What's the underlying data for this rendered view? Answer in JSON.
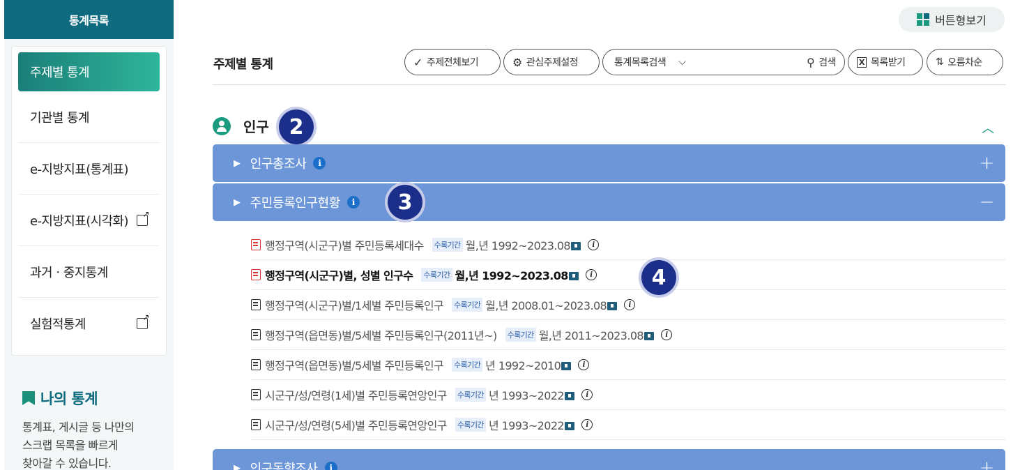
{
  "sidebar": {
    "header": "통계목록",
    "items": [
      {
        "label": "주제별 통계"
      },
      {
        "label": "기관별 통계"
      },
      {
        "label": "e-지방지표(통계표)"
      },
      {
        "label": "e-지방지표(시각화)"
      },
      {
        "label": "과거ㆍ중지통계"
      },
      {
        "label": "실험적통계"
      }
    ],
    "my_stats": {
      "title": "나의 통계",
      "desc_line1": "통계표, 게시글 등 나만의",
      "desc_line2": "스크랩 목록을 빠르게",
      "desc_line3": "찾아갈 수 있습니다."
    }
  },
  "top": {
    "view_button": "버튼형보기"
  },
  "page_title": "주제별 통계",
  "toolbar": {
    "all_topics": "주제전체보기",
    "interest": "관심주제설정",
    "search_select": "통계목록검색",
    "search_button": "검색",
    "download_list": "목록받기",
    "sort": "오름차순"
  },
  "section": {
    "title": "인구"
  },
  "badges": {
    "b2": "2",
    "b3": "3",
    "b4": "4"
  },
  "bands": [
    {
      "label": "인구총조사",
      "toggle": "+"
    },
    {
      "label": "주민등록인구현황",
      "toggle": "−"
    },
    {
      "label": "인구동향조사",
      "toggle": "+"
    }
  ],
  "rows": [
    {
      "name": "행정구역(시군구)별 주민등록세대수",
      "tag": "수록기간",
      "period": "월,년 1992~2023.08"
    },
    {
      "name": "행정구역(시군구)별, 성별 인구수",
      "tag": "수록기간",
      "period": "월,년 1992~2023.08"
    },
    {
      "name": "행정구역(시군구)별/1세별 주민등록인구",
      "tag": "수록기간",
      "period": "월,년 2008.01~2023.08"
    },
    {
      "name": "행정구역(읍면동)별/5세별 주민등록인구(2011년~)",
      "tag": "수록기간",
      "period": "월,년 2011~2023.08"
    },
    {
      "name": "행정구역(읍면동)별/5세별 주민등록인구",
      "tag": "수록기간",
      "period": "년 1992~2010"
    },
    {
      "name": "시군구/성/연령(1세)별 주민등록연앙인구",
      "tag": "수록기간",
      "period": "년 1993~2022"
    },
    {
      "name": "시군구/성/연령(5세)별 주민등록연앙인구",
      "tag": "수록기간",
      "period": "년 1993~2022"
    }
  ],
  "colors": {
    "brand": "#0e6b7f",
    "accent": "#1a9b80",
    "band": "#6d96d8",
    "badge": "#1b2f8a"
  }
}
